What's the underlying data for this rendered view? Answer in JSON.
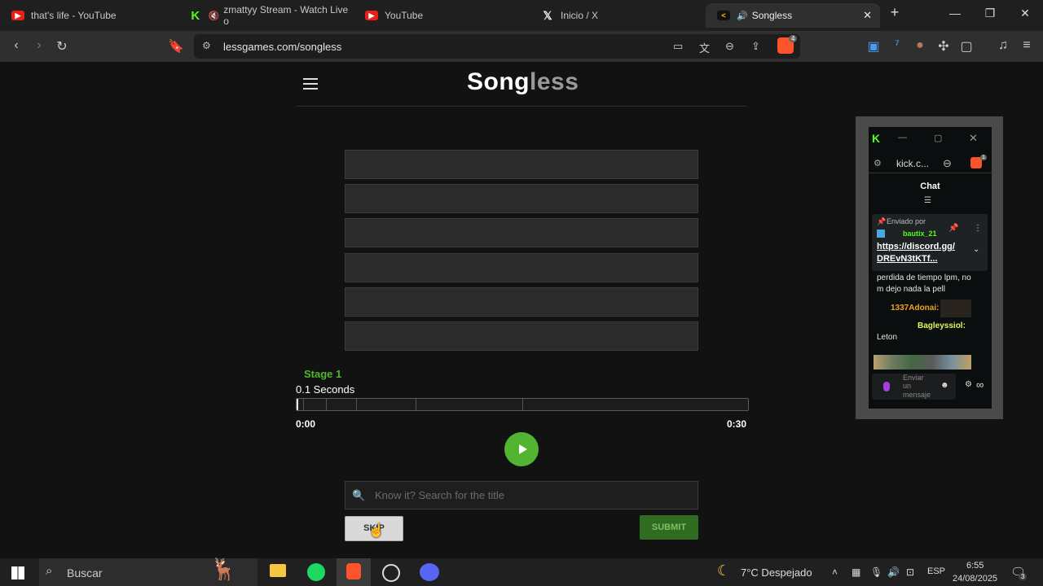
{
  "browser": {
    "tabs": [
      {
        "title": "that's life - YouTube",
        "icon": "youtube-icon"
      },
      {
        "title": "zmattyy Stream - Watch Live o",
        "icon": "kick-icon"
      },
      {
        "title": "YouTube",
        "icon": "youtube-icon"
      },
      {
        "title": "Inicio / X",
        "icon": "x-icon"
      },
      {
        "title": "Songless",
        "icon": "songless-icon",
        "active": true
      }
    ],
    "url": "lessgames.com/songless",
    "brave_badge": "4"
  },
  "game": {
    "logo_main": "Song",
    "logo_dim": "less",
    "stage": "Stage 1",
    "seconds": "0.1 Seconds",
    "progress_fraction": 0.003,
    "time_start": "0:00",
    "time_end": "0:30",
    "search_placeholder": "Know it? Search for the title",
    "skip_label": "SKIP",
    "submit_label": "SUBMIT",
    "guess_slots": 6
  },
  "popup": {
    "url_short": "kick.c...",
    "chat_title": "Chat",
    "pinned_by": "Enviado por",
    "pinned_user": "bautix_21",
    "pinned_link1": "https://discord.gg/",
    "pinned_link2": "DREvN3tKTf...",
    "msg1": "perdida de tiempo lpm, no",
    "msg1b": "m dejo nada la pell",
    "user2": "1337Adonai:",
    "user3": "Bagleyssiol:",
    "msg3": "Leton",
    "send_line1": "Enviar",
    "send_line2": "un",
    "send_line3": "mensaje",
    "infinity": "∞",
    "brave_badge": "1"
  },
  "taskbar": {
    "search_label": "Buscar",
    "weather": "7°C  Despejado",
    "lang": "ESP",
    "time": "6:55",
    "date": "24/08/2025",
    "notif_count": "3"
  }
}
